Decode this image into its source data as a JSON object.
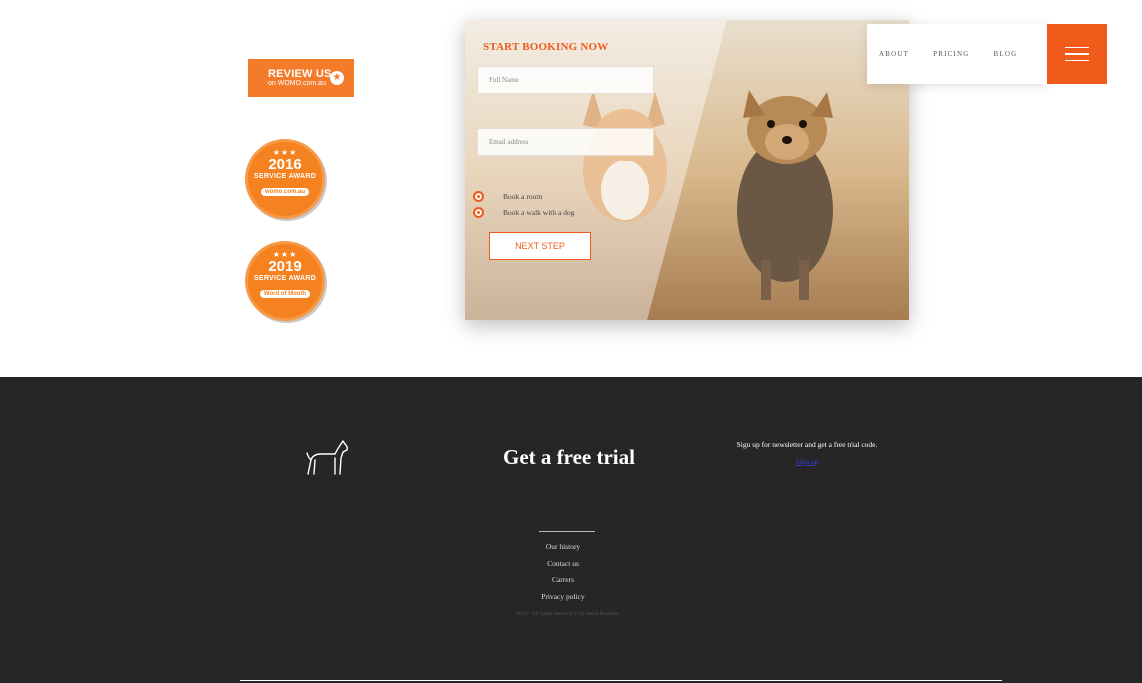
{
  "review_badge": {
    "line1": "REVIEW US",
    "line2": "on WOMO.com.au",
    "icon": "star-icon"
  },
  "awards": [
    {
      "year": "2016",
      "label": "SERVICE AWARD",
      "brand": "womo.com.au"
    },
    {
      "year": "2019",
      "label": "SERVICE AWARD",
      "brand": "Word of Mouth"
    }
  ],
  "booking": {
    "title": "START BOOKING NOW",
    "name_placeholder": "Full Name",
    "email_placeholder": "Email address",
    "options": [
      "Book a room",
      "Book a walk with a dog"
    ],
    "next_label": "NEXT STEP"
  },
  "nav": {
    "items": [
      "ABOUT",
      "PRICING",
      "BLOG"
    ],
    "menu_icon": "hamburger-menu-icon"
  },
  "footer": {
    "title": "Get a free trial",
    "newsletter_text": "Sign up for newsletter and get a free trial code.",
    "signup_label": "Sign up",
    "links": [
      "Our history",
      "Contact us",
      "Carrers",
      "Privacy policy"
    ],
    "copyright": "2019 - All rights reserved © by Berra Bradska",
    "logo_icon": "dog-icon"
  },
  "colors": {
    "accent": "#f05a1a",
    "award": "#f58220",
    "footer_bg": "#262626"
  }
}
